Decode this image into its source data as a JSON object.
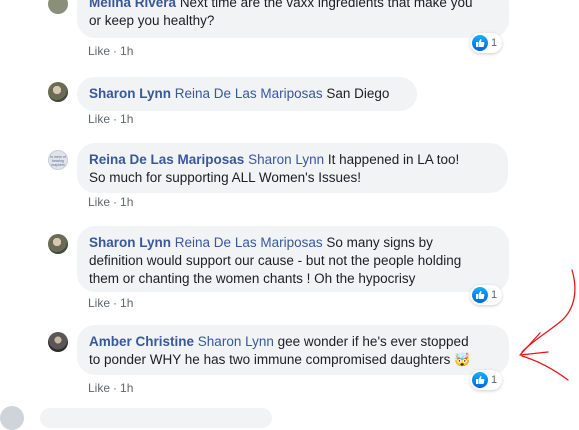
{
  "comments": [
    {
      "author": "Melina Rivera",
      "tag": "",
      "text_line1": "Next time are the vaxx ingredients that make you",
      "text_line2": "or keep you healthy?",
      "like_label": "Like",
      "time": "1h",
      "reaction_count": "1"
    },
    {
      "author": "Sharon Lynn",
      "tag": "Reina De Las Mariposas",
      "text": "San Diego",
      "like_label": "Like",
      "time": "1h"
    },
    {
      "author": "Reina De Las Mariposas",
      "tag": "Sharon Lynn",
      "text_line1": "It happened in LA too!",
      "text_line2": "So much for supporting ALL Women's Issues!",
      "like_label": "Like",
      "time": "1h",
      "avatar_text": "In mem of bearing mayhem"
    },
    {
      "author": "Sharon Lynn",
      "tag": "Reina De Las Mariposas",
      "text_line1": "So many signs by",
      "text_line2": "definition would support our cause - but not the people holding",
      "text_line3": "them or chanting the women chants ! Oh the hypocrisy",
      "like_label": "Like",
      "time": "1h",
      "reaction_count": "1"
    },
    {
      "author": "Amber Christine",
      "tag": "Sharon Lynn",
      "text_line1": "gee wonder if he's ever stopped",
      "text_line2": "to ponder WHY he has two immune compromised daughters",
      "emoji": "🤯",
      "like_label": "Like",
      "time": "1h",
      "reaction_count": "1"
    }
  ],
  "dot": "·",
  "colors": {
    "link": "#385898",
    "bubble": "#f2f3f5",
    "meta": "#606770",
    "annotation": "#e8151b"
  }
}
